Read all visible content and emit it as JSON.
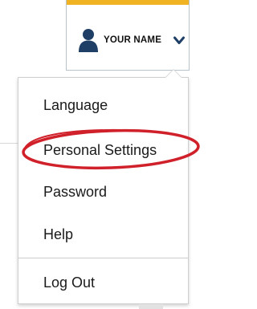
{
  "header": {
    "user_label": "YOUR NAME",
    "icons": {
      "user": "person-icon",
      "toggle": "chevron-down-icon"
    }
  },
  "menu": {
    "items": [
      {
        "label": "Language"
      },
      {
        "label": "Personal Settings",
        "highlighted": true
      },
      {
        "label": "Password"
      },
      {
        "label": "Help"
      },
      {
        "label": "Log Out"
      }
    ]
  },
  "colors": {
    "accent_bar": "#f0b323",
    "icon_blue": "#1f3f66",
    "highlight_circle": "#d0202a"
  }
}
